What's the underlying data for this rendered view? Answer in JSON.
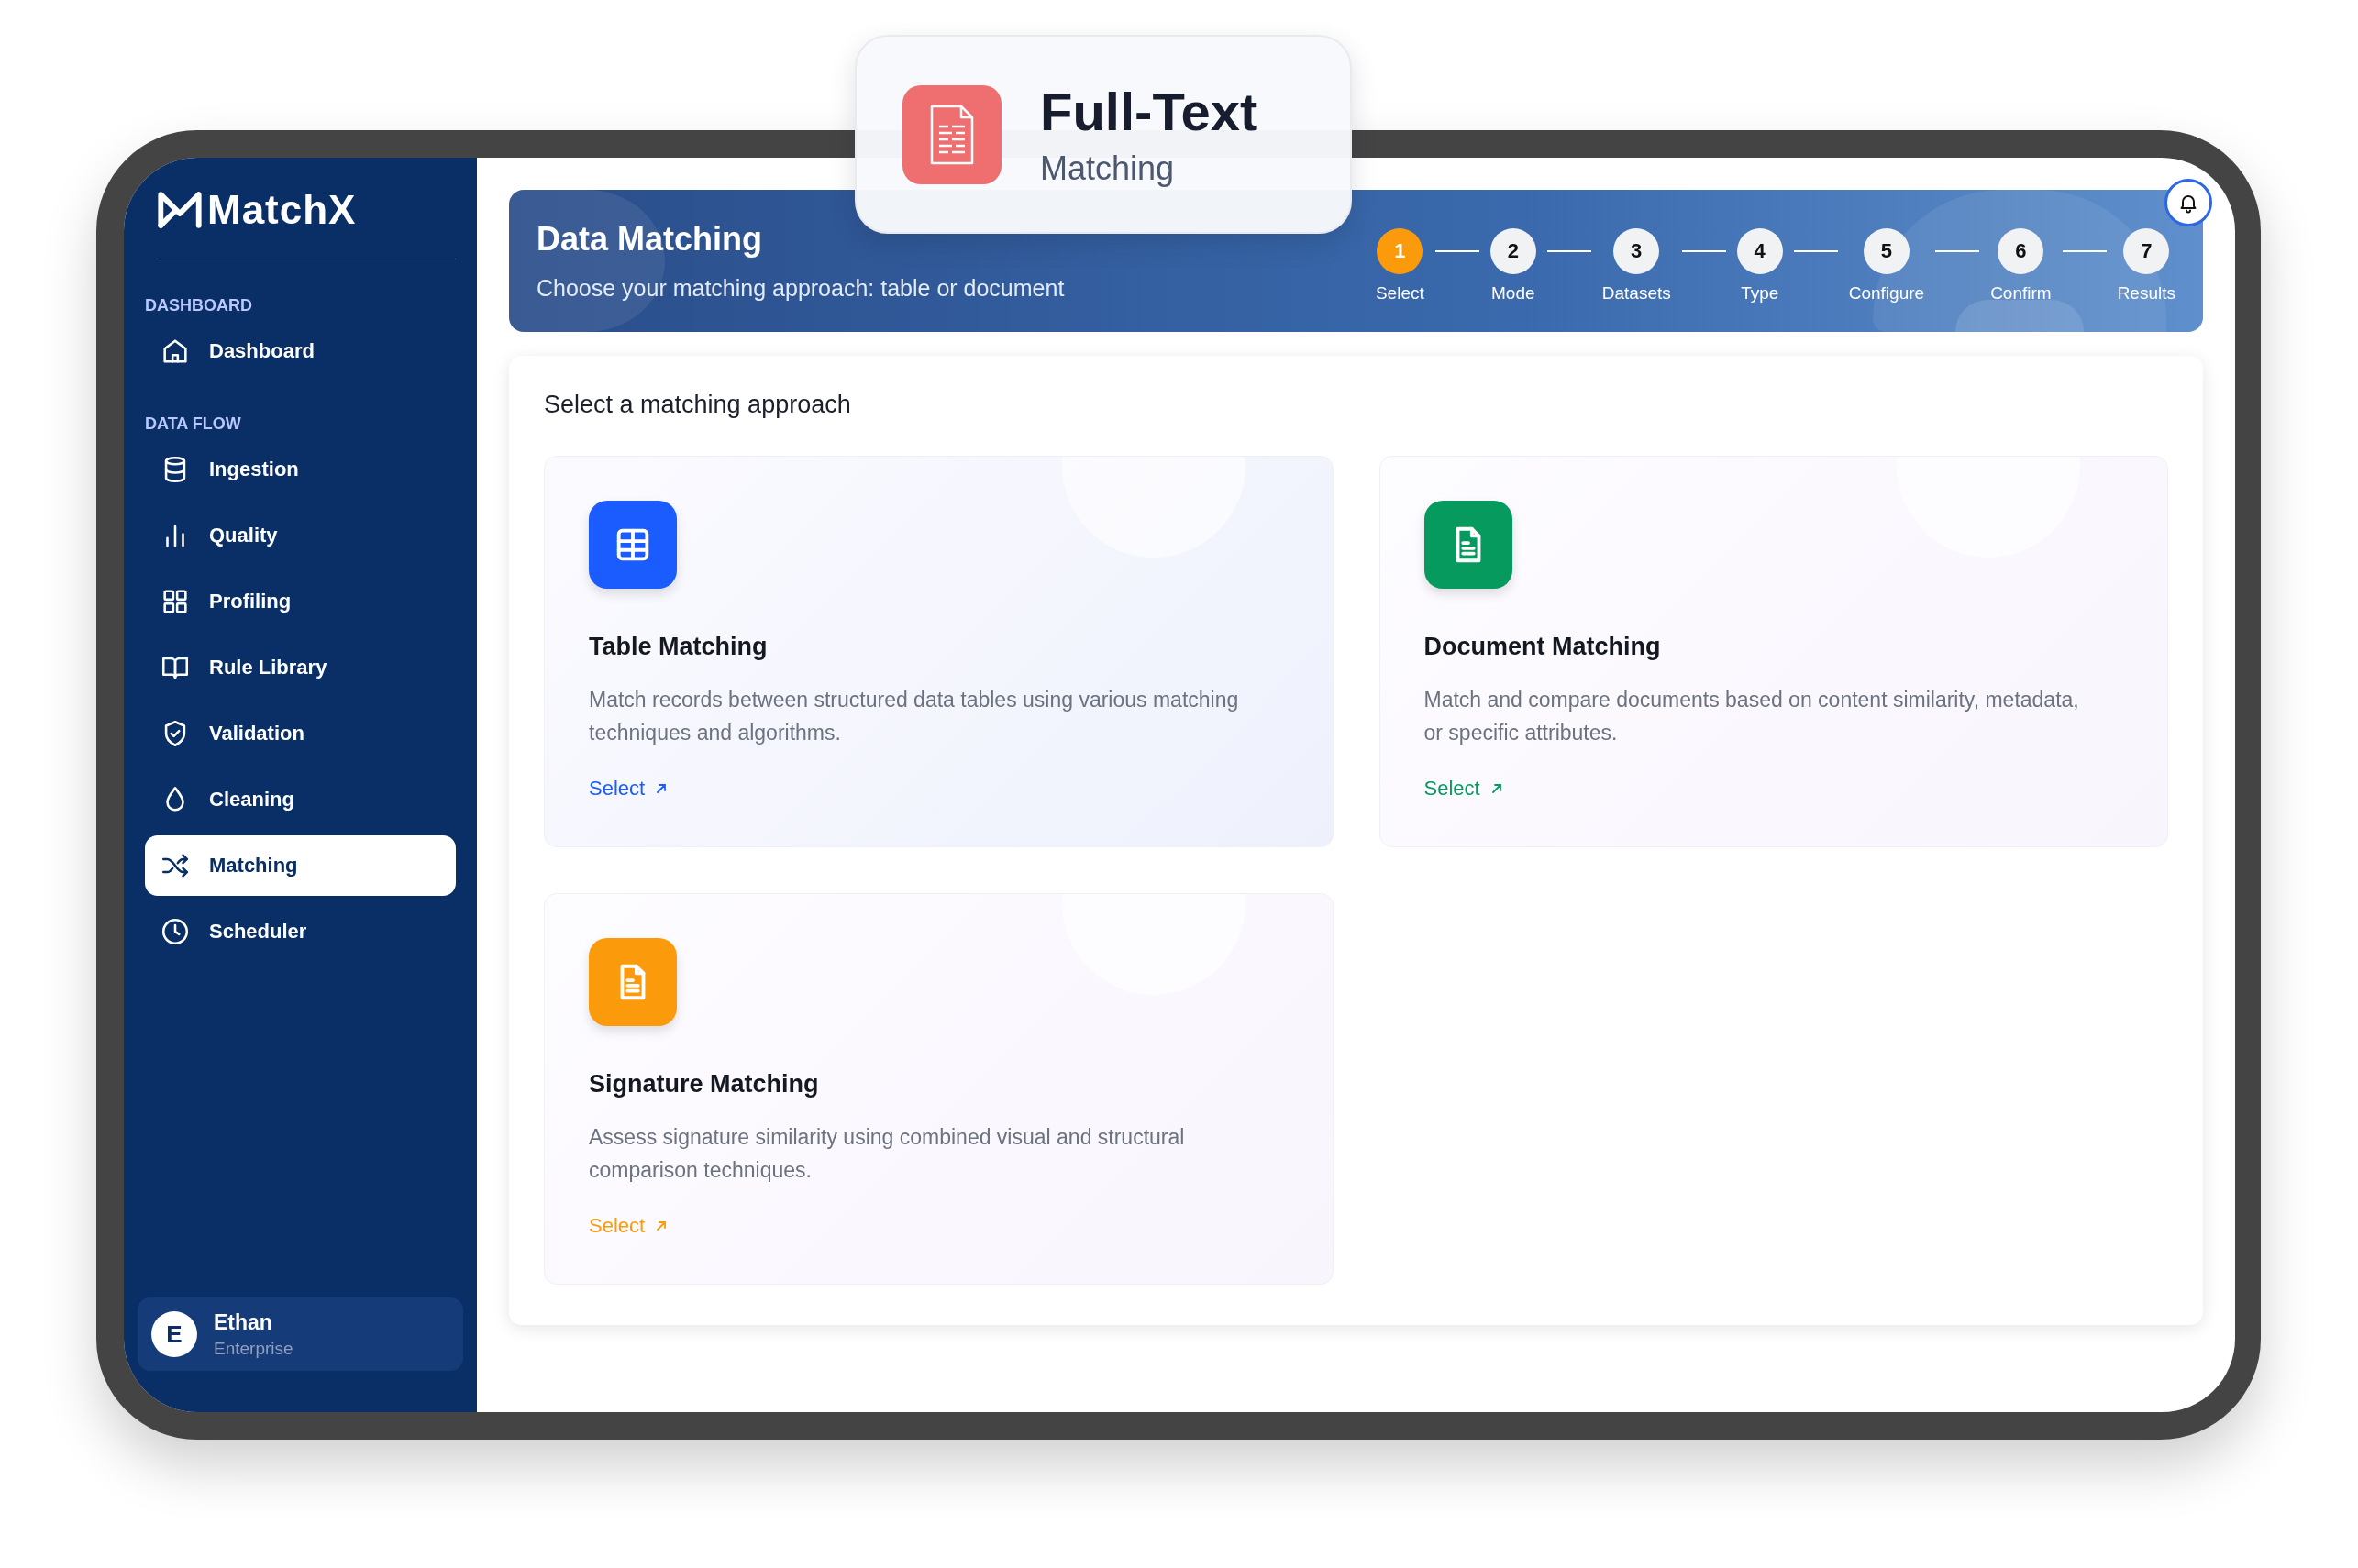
{
  "feature_badge": {
    "title": "Full-Text",
    "subtitle": "Matching"
  },
  "sidebar": {
    "logo": "MatchX",
    "sections": [
      {
        "label": "DASHBOARD",
        "items": [
          {
            "label": "Dashboard",
            "selected": false
          }
        ]
      },
      {
        "label": "DATA FLOW",
        "items": [
          {
            "label": "Ingestion",
            "selected": false
          },
          {
            "label": "Quality",
            "selected": false
          },
          {
            "label": "Profiling",
            "selected": false
          },
          {
            "label": "Rule Library",
            "selected": false
          },
          {
            "label": "Validation",
            "selected": false
          },
          {
            "label": "Cleaning",
            "selected": false
          },
          {
            "label": "Matching",
            "selected": true
          },
          {
            "label": "Scheduler",
            "selected": false
          }
        ]
      }
    ],
    "user": {
      "initial": "E",
      "name": "Ethan",
      "plan": "Enterprise"
    }
  },
  "header": {
    "title": "Data Matching",
    "subtitle": "Choose your matching approach: table or document",
    "steps": [
      {
        "number": "1",
        "label": "Select",
        "selected": true
      },
      {
        "number": "2",
        "label": "Mode",
        "selected": false
      },
      {
        "number": "3",
        "label": "Datasets",
        "selected": false
      },
      {
        "number": "4",
        "label": "Type",
        "selected": false
      },
      {
        "number": "5",
        "label": "Configure",
        "selected": false
      },
      {
        "number": "6",
        "label": "Confirm",
        "selected": false
      },
      {
        "number": "7",
        "label": "Results",
        "selected": false
      }
    ]
  },
  "content": {
    "heading": "Select a matching approach",
    "cards": [
      {
        "title": "Table Matching",
        "description": "Match records between structured data tables using various matching techniques and algorithms.",
        "action": "Select",
        "color": "#1a5cff"
      },
      {
        "title": "Document Matching",
        "description": "Match and compare documents based on content similarity, metadata, or specific attributes.",
        "action": "Select",
        "color": "#079a5f"
      },
      {
        "title": "Signature Matching",
        "description": "Assess signature similarity using combined visual and structural comparison techniques.",
        "action": "Select",
        "color": "#fb9a0a"
      }
    ]
  }
}
